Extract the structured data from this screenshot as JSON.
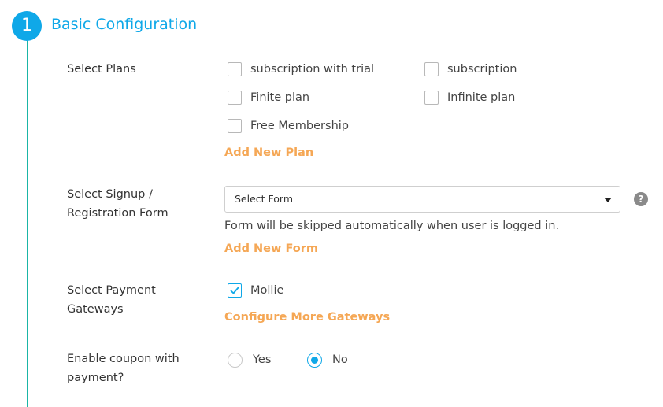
{
  "step": {
    "number": "1",
    "title": "Basic Configuration"
  },
  "plans": {
    "label": "Select Plans",
    "options": [
      {
        "label": "subscription with trial",
        "checked": false
      },
      {
        "label": "subscription",
        "checked": false
      },
      {
        "label": "Finite plan",
        "checked": false
      },
      {
        "label": "Infinite plan",
        "checked": false
      },
      {
        "label": "Free Membership",
        "checked": false
      }
    ],
    "add_link": "Add New Plan"
  },
  "signup": {
    "label_line1": "Select Signup /",
    "label_line2": "Registration Form",
    "select_value": "Select Form",
    "hint": "Form will be skipped automatically when user is logged in.",
    "add_link": "Add New Form",
    "help_icon": "question-circle-icon"
  },
  "gateways": {
    "label_line1": "Select Payment",
    "label_line2": "Gateways",
    "options": [
      {
        "label": "Mollie",
        "checked": true
      }
    ],
    "configure_link": "Configure More Gateways"
  },
  "coupon": {
    "label_line1": "Enable coupon with",
    "label_line2": "payment?",
    "options": [
      {
        "label": "Yes",
        "selected": false
      },
      {
        "label": "No",
        "selected": true
      }
    ]
  },
  "colors": {
    "accent": "#0fa8e8",
    "link": "#f5a755",
    "timeline": "#1ab5a6"
  }
}
